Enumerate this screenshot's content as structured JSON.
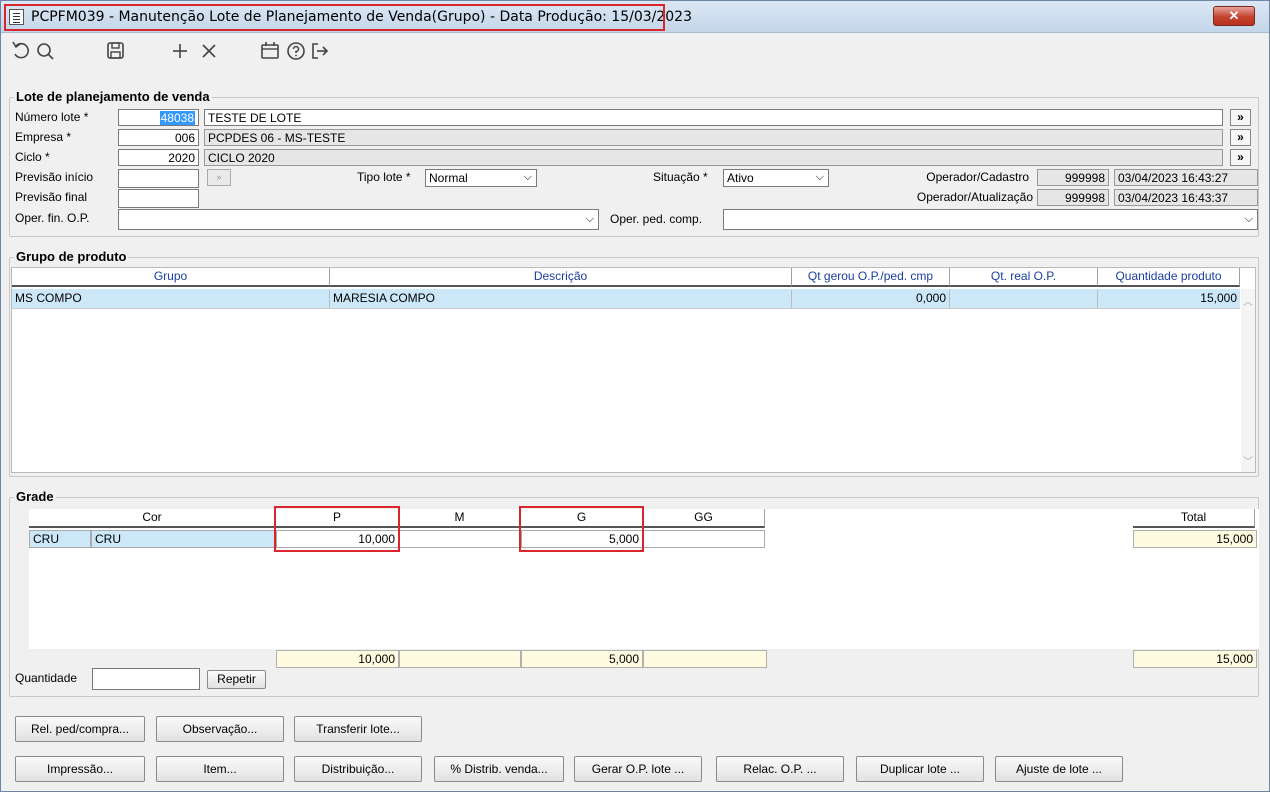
{
  "window": {
    "title": "PCPFM039 - Manutenção Lote de Planejamento de Venda(Grupo) - Data Produção: 15/03/2023",
    "close_glyph": "✕"
  },
  "toolbar": {
    "icons": [
      "refresh-icon",
      "search-icon",
      "save-icon",
      "add-icon",
      "delete-icon",
      "calendar-icon",
      "help-icon",
      "exit-icon"
    ]
  },
  "lote": {
    "section_title": "Lote de planejamento de venda",
    "numero_label": "Número lote *",
    "numero_value": "48038",
    "numero_desc": "TESTE DE LOTE",
    "empresa_label": "Empresa *",
    "empresa_value": "006",
    "empresa_desc": "PCPDES 06 - MS-TESTE",
    "ciclo_label": "Ciclo *",
    "ciclo_value": "2020",
    "ciclo_desc": "CICLO 2020",
    "nav_glyph": "»",
    "previsao_inicio_label": "Previsão início",
    "previsao_final_label": "Previsão final",
    "tipo_lote_label": "Tipo lote *",
    "tipo_lote_value": "Normal",
    "situacao_label": "Situação *",
    "situacao_value": "Ativo",
    "operador_cadastro_label": "Operador/Cadastro",
    "operador_cadastro_code": "999998",
    "operador_cadastro_date": "03/04/2023 16:43:27",
    "operador_atualizacao_label": "Operador/Atualização",
    "operador_atualizacao_code": "999998",
    "operador_atualizacao_date": "03/04/2023 16:43:37",
    "oper_fin_label": "Oper. fin. O.P.",
    "oper_ped_label": "Oper. ped. comp."
  },
  "grupo": {
    "section_title": "Grupo de produto",
    "columns": [
      "Grupo",
      "Descrição",
      "Qt gerou O.P./ped. cmp",
      "Qt. real O.P.",
      "Quantidade produto"
    ],
    "rows": [
      {
        "grupo": "MS COMPO",
        "descricao": "MARESIA COMPO",
        "qt_gerou": "0,000",
        "qt_real": "",
        "quantidade": "15,000"
      }
    ]
  },
  "grade": {
    "section_title": "Grade",
    "columns": [
      "Cor",
      "P",
      "M",
      "G",
      "GG"
    ],
    "total_label": "Total",
    "rows": [
      {
        "cor_code": "CRU",
        "cor_desc": "CRU",
        "p": "10,000",
        "m": "",
        "g": "5,000",
        "gg": "",
        "total": "15,000"
      }
    ],
    "totals": {
      "p": "10,000",
      "m": "",
      "g": "5,000",
      "gg": "",
      "total": "15,000"
    },
    "quantidade_label": "Quantidade",
    "repetir_label": "Repetir"
  },
  "buttons_row1": [
    "Rel. ped/compra...",
    "Observação...",
    "Transferir lote..."
  ],
  "buttons_row2": [
    "Impressão...",
    "Item...",
    "Distribuição...",
    "% Distrib. venda...",
    "Gerar O.P. lote ...",
    "Relac. O.P. ...",
    "Duplicar lote ...",
    "Ajuste de lote ..."
  ],
  "colors": {
    "highlight_red": "#d9262c",
    "selection_blue": "#cce8f8",
    "header_blue": "#1b3fa0",
    "total_yellow": "#fffbe0"
  }
}
